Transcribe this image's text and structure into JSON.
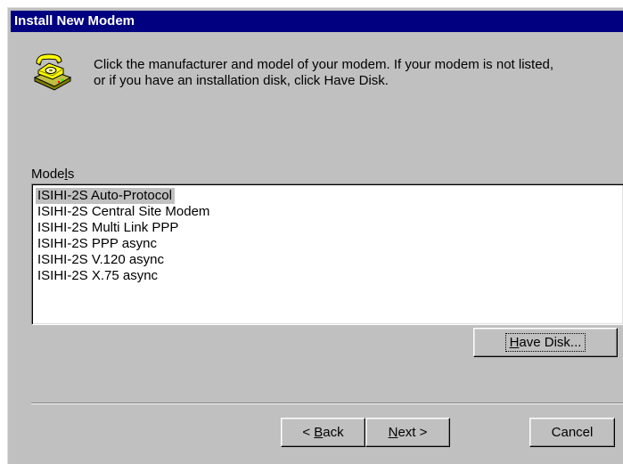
{
  "window": {
    "title": "Install New Modem"
  },
  "instructions": {
    "line1": "Click the manufacturer and model of your modem. If your modem is not listed,",
    "line2": "or if you have an installation disk, click Have Disk."
  },
  "models": {
    "label_prefix": "Mode",
    "label_accel": "l",
    "label_suffix": "s",
    "items": [
      {
        "label": "ISIHI-2S Auto-Protocol",
        "selected": true
      },
      {
        "label": "ISIHI-2S Central Site Modem",
        "selected": false
      },
      {
        "label": "ISIHI-2S Multi Link PPP",
        "selected": false
      },
      {
        "label": "ISIHI-2S PPP async",
        "selected": false
      },
      {
        "label": "ISIHI-2S V.120 async",
        "selected": false
      },
      {
        "label": "ISIHI-2S X.75 async",
        "selected": false
      }
    ]
  },
  "buttons": {
    "have_disk": {
      "accel": "H",
      "rest": "ave Disk..."
    },
    "back": {
      "prefix": "< ",
      "accel": "B",
      "rest": "ack"
    },
    "next": {
      "accel": "N",
      "rest": "ext >"
    },
    "cancel": {
      "label": "Cancel"
    }
  },
  "icons": {
    "modem": "telephone-modem-icon"
  },
  "colors": {
    "titlebar": "#000080",
    "face": "#c0c0c0",
    "selection": "#c0c0c0"
  }
}
